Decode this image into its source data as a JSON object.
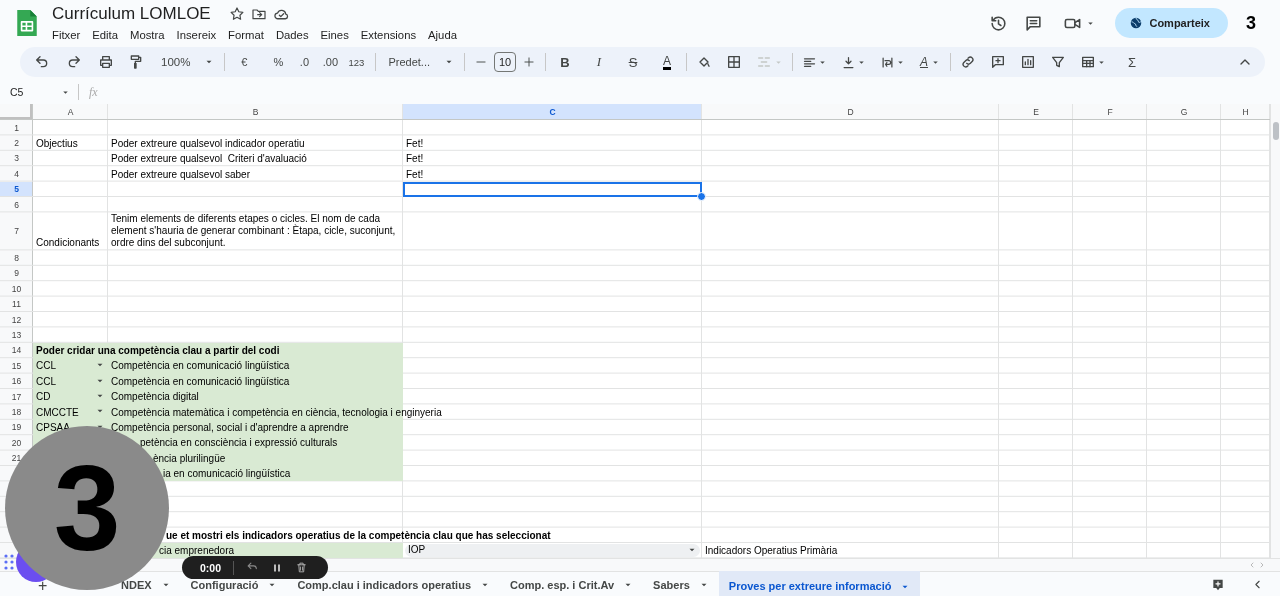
{
  "document": {
    "title": "Currículum LOMLOE"
  },
  "menu": [
    "Fitxer",
    "Edita",
    "Mostra",
    "Insereix",
    "Format",
    "Dades",
    "Eines",
    "Extensions",
    "Ajuda"
  ],
  "share_button": "Comparteix",
  "header_counter": "3",
  "toolbar": {
    "zoom": "100%",
    "currency": "€",
    "percent": "%",
    "decrease_decimals": ".0",
    "increase_decimals": ".00",
    "number_format": "123",
    "font": "Predet...",
    "font_size": "10",
    "bold": "B",
    "italic": "I",
    "strikethrough": "S",
    "text_color": "A",
    "rotation": "A",
    "sum": "Σ"
  },
  "formula_bar": {
    "cell_ref": "C5",
    "fx_label": "fx"
  },
  "columns": [
    {
      "label": "A",
      "selected": false
    },
    {
      "label": "B",
      "selected": false
    },
    {
      "label": "C",
      "selected": true
    },
    {
      "label": "D",
      "selected": false
    },
    {
      "label": "E",
      "selected": false
    },
    {
      "label": "F",
      "selected": false
    },
    {
      "label": "G",
      "selected": false
    },
    {
      "label": "H",
      "selected": false
    }
  ],
  "rows": [
    {
      "number": "1",
      "selected": false,
      "cells": []
    },
    {
      "number": "2",
      "selected": false,
      "cells": [
        {
          "text": "Objectius"
        },
        {
          "text": "Poder extreure qualsevol indicador operatiu"
        },
        {
          "text": "Fet!"
        }
      ]
    },
    {
      "number": "3",
      "selected": false,
      "cells": [
        {},
        {
          "text": "Poder extreure qualsevol  Criteri d'avaluació"
        },
        {
          "text": "Fet!"
        }
      ]
    },
    {
      "number": "4",
      "selected": false,
      "cells": [
        {},
        {
          "text": "Poder extreure qualsevol saber"
        },
        {
          "text": "Fet!"
        }
      ]
    },
    {
      "number": "5",
      "selected": true,
      "cells": []
    },
    {
      "number": "6",
      "selected": false,
      "cells": []
    },
    {
      "number": "7",
      "selected": false,
      "cells": [
        {
          "text": "Condicionants"
        },
        {
          "text": "Tenim elements de diferents etapes o cicles. El nom de cada element s'hauria de generar combinant : Ètapa, cicle, suconjunt, ordre dins del subconjunt.",
          "wrap": true
        }
      ]
    },
    {
      "number": "8",
      "selected": false,
      "cells": []
    },
    {
      "number": "9",
      "selected": false,
      "cells": []
    },
    {
      "number": "10",
      "selected": false,
      "cells": []
    },
    {
      "number": "11",
      "selected": false,
      "cells": []
    },
    {
      "number": "12",
      "selected": false,
      "cells": []
    },
    {
      "number": "13",
      "selected": false,
      "cells": []
    },
    {
      "number": "14",
      "selected": false,
      "cells": [
        {
          "text": "Poder cridar una competència clau a partir del codi",
          "bold": true,
          "shaded": true
        },
        {
          "shaded": true
        }
      ]
    },
    {
      "number": "15",
      "selected": false,
      "cells": [
        {
          "text": "CCL",
          "kind": "dropdown",
          "shaded": true
        },
        {
          "text": "Competència en comunicació lingüística",
          "shaded": true
        }
      ]
    },
    {
      "number": "16",
      "selected": false,
      "cells": [
        {
          "text": "CCL",
          "kind": "dropdown",
          "shaded": true
        },
        {
          "text": "Competència en comunicació lingüística",
          "shaded": true
        }
      ]
    },
    {
      "number": "17",
      "selected": false,
      "cells": [
        {
          "text": "CD",
          "kind": "dropdown",
          "shaded": true
        },
        {
          "text": "Competència digital",
          "shaded": true
        }
      ]
    },
    {
      "number": "18",
      "selected": false,
      "cells": [
        {
          "text": "CMCCTE",
          "kind": "dropdown",
          "shaded": true
        },
        {
          "text": "Competència matemàtica i competència en ciència, tecnologia i enginyeria",
          "shaded": true
        }
      ]
    },
    {
      "number": "19",
      "selected": false,
      "cells": [
        {
          "text": "CPSAA",
          "kind": "dropdown",
          "shaded": true
        },
        {
          "text": "Competència personal, social i d'aprendre a aprendre",
          "shaded": true
        }
      ]
    },
    {
      "number": "20",
      "selected": false,
      "cells": [
        {
          "shaded": true
        },
        {
          "text": "petència en consciència i expressió culturals",
          "shaded": true
        }
      ]
    },
    {
      "number": "21",
      "selected": false,
      "cells": [
        {},
        {
          "text": "ència plurilingüe",
          "shaded": true
        }
      ]
    },
    {
      "selected": false,
      "cells": [
        {},
        {
          "text": "ia en comunicació lingüística",
          "shaded": true
        }
      ]
    },
    {
      "selected": false,
      "cells": []
    },
    {
      "selected": false,
      "cells": []
    },
    {
      "selected": false,
      "cells": []
    },
    {
      "selected": false,
      "cells": [
        {
          "text": "ue et mostri els indicadors operatius de la competència clau que has seleccionat",
          "bold": true
        }
      ]
    },
    {
      "selected": false,
      "cells": [
        {},
        {
          "text": "cia emprenedora",
          "shaded": true
        },
        {
          "text": "IOP",
          "kind": "dropdown"
        },
        {
          "text": "Indicadors Operatius Primària"
        }
      ]
    }
  ],
  "sheet_tabs": {
    "add": "+",
    "tabs": [
      {
        "label": "NDEX",
        "selected": false
      },
      {
        "label": "Configuració",
        "selected": false
      },
      {
        "label": "Comp.clau i indicadors operatius",
        "selected": false
      },
      {
        "label": "Comp. esp. i Crit.Av",
        "selected": false
      },
      {
        "label": "Sabers",
        "selected": false
      },
      {
        "label": "Proves per extreure informació",
        "selected": true
      }
    ]
  },
  "recorder": {
    "countdown": "3",
    "time": "0:00"
  }
}
